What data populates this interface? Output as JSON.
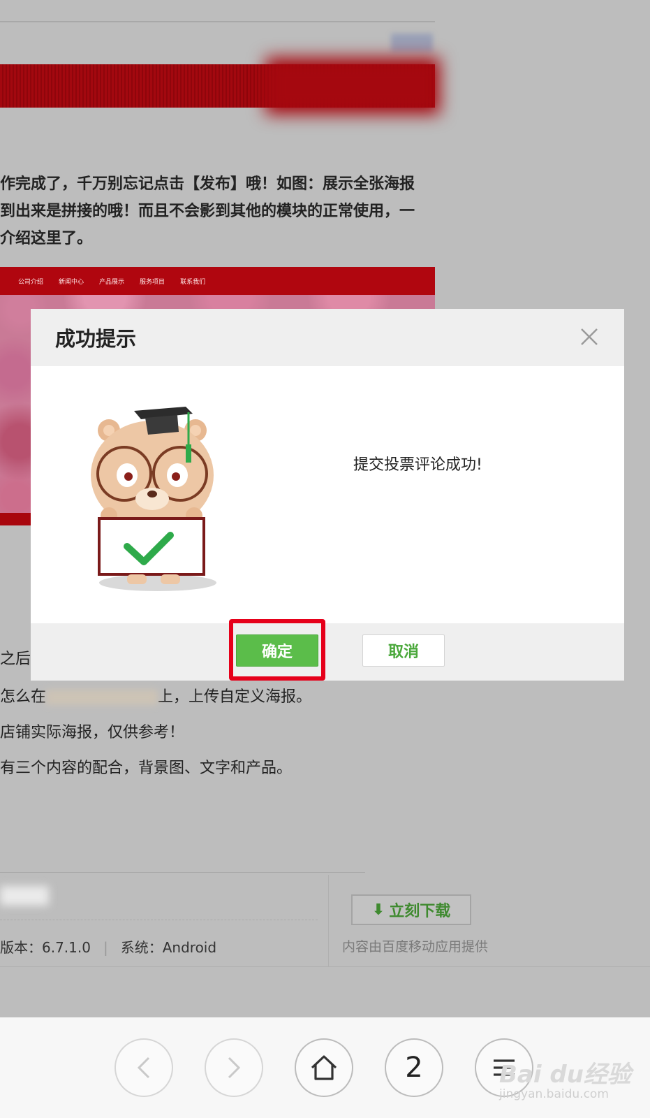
{
  "article": {
    "intro_lines": [
      "作完成了，千万别忘记点击【发布】哦！如图：展示全张海报",
      "到出来是拼接的哦！而且不会影到其他的模块的正常使用，一",
      "介绍这里了。"
    ],
    "screenshot_nav": [
      "公司介绍",
      "新闻中心",
      "产品展示",
      "服务项目",
      "联系我们"
    ],
    "after_dialog_fragment": "之后得",
    "lower_lines": {
      "line1_prefix": "怎么在",
      "line1_suffix": "上，上传自定义海报。",
      "line2": "店铺实际海报，仅供参考！",
      "line3": "有三个内容的配合，背景图、文字和产品。"
    }
  },
  "app_card": {
    "meta_version": "版本：6.7.1.0",
    "meta_system": "系统：Android",
    "download_label": "立刻下载",
    "provider": "内容由百度移动应用提供"
  },
  "dialog": {
    "title": "成功提示",
    "message": "提交投票评论成功!",
    "ok_label": "确定",
    "cancel_label": "取消",
    "close_icon": "close-icon"
  },
  "bottom_nav": {
    "tab_count": "2",
    "icons": [
      "back-icon",
      "forward-icon",
      "home-icon",
      "tabs-icon",
      "menu-icon"
    ]
  },
  "watermark": {
    "main": "Bai du经验",
    "sub": "jingyan.baidu.com"
  },
  "colors": {
    "ok_button": "#5bbd4a",
    "highlight": "#e6001a",
    "overlay": "#bdbdbd"
  }
}
